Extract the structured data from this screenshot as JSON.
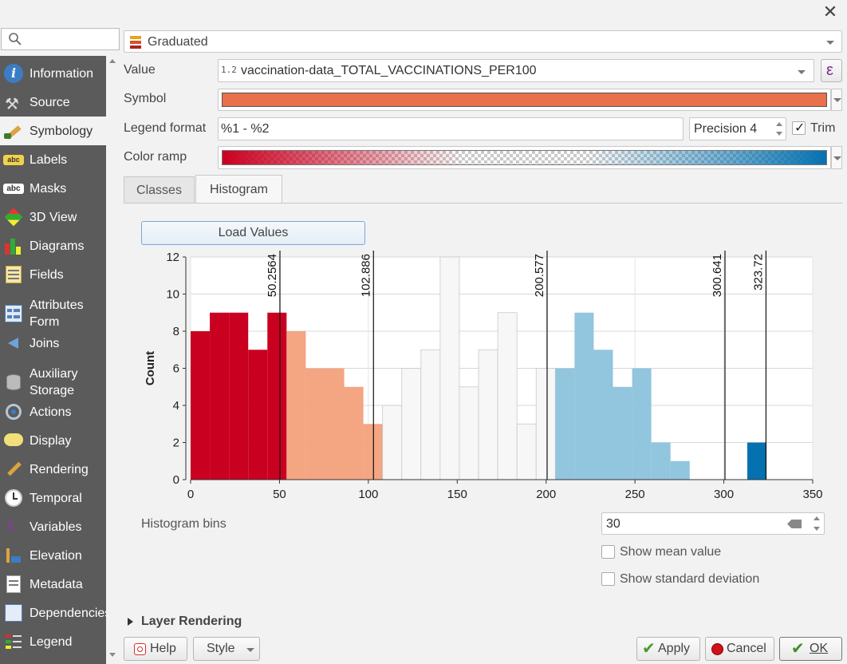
{
  "sidebar": {
    "search_placeholder": "",
    "items": [
      {
        "label": "Information",
        "icon": "info-icon",
        "active": false
      },
      {
        "label": "Source",
        "icon": "source-wrench-icon",
        "active": false
      },
      {
        "label": "Symbology",
        "icon": "paintbrush-icon",
        "active": true
      },
      {
        "label": "Labels",
        "icon": "labels-abc-icon",
        "active": false
      },
      {
        "label": "Masks",
        "icon": "masks-abc-icon",
        "active": false
      },
      {
        "label": "3D View",
        "icon": "cube-3d-icon",
        "active": false
      },
      {
        "label": "Diagrams",
        "icon": "diagrams-icon",
        "active": false
      },
      {
        "label": "Fields",
        "icon": "fields-icon",
        "active": false
      },
      {
        "label": "Attributes\nForm",
        "icon": "attributes-form-icon",
        "active": false
      },
      {
        "label": "Joins",
        "icon": "joins-icon",
        "active": false
      },
      {
        "label": "Auxiliary\nStorage",
        "icon": "auxiliary-storage-icon",
        "active": false
      },
      {
        "label": "Actions",
        "icon": "actions-icon",
        "active": false
      },
      {
        "label": "Display",
        "icon": "display-speech-icon",
        "active": false
      },
      {
        "label": "Rendering",
        "icon": "rendering-brush-icon",
        "active": false
      },
      {
        "label": "Temporal",
        "icon": "clock-icon",
        "active": false
      },
      {
        "label": "Variables",
        "icon": "epsilon-icon",
        "active": false
      },
      {
        "label": "Elevation",
        "icon": "elevation-icon",
        "active": false
      },
      {
        "label": "Metadata",
        "icon": "metadata-icon",
        "active": false
      },
      {
        "label": "Dependencies",
        "icon": "dependencies-icon",
        "active": false
      },
      {
        "label": "Legend",
        "icon": "legend-icon",
        "active": false
      }
    ]
  },
  "renderer": {
    "type_label": "Graduated"
  },
  "form": {
    "value_label": "Value",
    "value_type_badge": "1.2",
    "value_field": "vaccination-data_TOTAL_VACCINATIONS_PER100",
    "symbol_label": "Symbol",
    "symbol_color": "#e8704a",
    "legend_format_label": "Legend format",
    "legend_format_value": "%1 - %2",
    "precision_value": "Precision 4",
    "trim_label": "Trim",
    "trim_checked": true,
    "color_ramp_label": "Color ramp"
  },
  "tabs": [
    {
      "label": "Classes",
      "active": false
    },
    {
      "label": "Histogram",
      "active": true
    }
  ],
  "histogram": {
    "load_values_label": "Load Values",
    "bins_label": "Histogram bins",
    "bins_value": "30",
    "show_mean_label": "Show mean value",
    "show_mean_checked": false,
    "show_std_label": "Show standard deviation",
    "show_std_checked": false
  },
  "chart_data": {
    "type": "bar",
    "title": "",
    "xlabel": "",
    "ylabel": "Count",
    "xlim": [
      0,
      350
    ],
    "ylim": [
      0,
      12
    ],
    "x_ticks": [
      0,
      50,
      100,
      150,
      200,
      250,
      300,
      350
    ],
    "y_ticks": [
      0,
      2,
      4,
      6,
      8,
      10,
      12
    ],
    "grid": true,
    "bins": [
      {
        "x0": 0,
        "x1": 10.8,
        "count": 8,
        "color": "#ca0020"
      },
      {
        "x0": 10.8,
        "x1": 21.6,
        "count": 9,
        "color": "#ca0020"
      },
      {
        "x0": 21.6,
        "x1": 32.4,
        "count": 9,
        "color": "#ca0020"
      },
      {
        "x0": 32.4,
        "x1": 43.2,
        "count": 7,
        "color": "#ca0020"
      },
      {
        "x0": 43.2,
        "x1": 54.0,
        "count": 9,
        "color": "#ca0020"
      },
      {
        "x0": 54.0,
        "x1": 64.8,
        "count": 8,
        "color": "#f4a582"
      },
      {
        "x0": 64.8,
        "x1": 75.6,
        "count": 6,
        "color": "#f4a582"
      },
      {
        "x0": 75.6,
        "x1": 86.4,
        "count": 6,
        "color": "#f4a582"
      },
      {
        "x0": 86.4,
        "x1": 97.2,
        "count": 5,
        "color": "#f4a582"
      },
      {
        "x0": 97.2,
        "x1": 108.0,
        "count": 3,
        "color": "#f4a582"
      },
      {
        "x0": 108.0,
        "x1": 118.8,
        "count": 4,
        "color": "#f7f7f7"
      },
      {
        "x0": 118.8,
        "x1": 129.6,
        "count": 6,
        "color": "#f7f7f7"
      },
      {
        "x0": 129.6,
        "x1": 140.4,
        "count": 7,
        "color": "#f7f7f7"
      },
      {
        "x0": 140.4,
        "x1": 151.2,
        "count": 12,
        "color": "#f7f7f7"
      },
      {
        "x0": 151.2,
        "x1": 162.0,
        "count": 5,
        "color": "#f7f7f7"
      },
      {
        "x0": 162.0,
        "x1": 172.8,
        "count": 7,
        "color": "#f7f7f7"
      },
      {
        "x0": 172.8,
        "x1": 183.6,
        "count": 9,
        "color": "#f7f7f7"
      },
      {
        "x0": 183.6,
        "x1": 194.4,
        "count": 3,
        "color": "#f7f7f7"
      },
      {
        "x0": 194.4,
        "x1": 205.2,
        "count": 6,
        "color": "#f7f7f7"
      },
      {
        "x0": 205.2,
        "x1": 216.0,
        "count": 6,
        "color": "#92c5de"
      },
      {
        "x0": 216.0,
        "x1": 226.8,
        "count": 9,
        "color": "#92c5de"
      },
      {
        "x0": 226.8,
        "x1": 237.6,
        "count": 7,
        "color": "#92c5de"
      },
      {
        "x0": 237.6,
        "x1": 248.4,
        "count": 5,
        "color": "#92c5de"
      },
      {
        "x0": 248.4,
        "x1": 259.2,
        "count": 6,
        "color": "#92c5de"
      },
      {
        "x0": 259.2,
        "x1": 270.0,
        "count": 2,
        "color": "#92c5de"
      },
      {
        "x0": 270.0,
        "x1": 280.8,
        "count": 1,
        "color": "#92c5de"
      },
      {
        "x0": 280.8,
        "x1": 291.6,
        "count": 0,
        "color": "#92c5de"
      },
      {
        "x0": 291.6,
        "x1": 302.4,
        "count": 0,
        "color": "#92c5de"
      },
      {
        "x0": 302.4,
        "x1": 313.2,
        "count": 0,
        "color": "#0571b0"
      },
      {
        "x0": 313.2,
        "x1": 324.0,
        "count": 2,
        "color": "#0571b0"
      }
    ],
    "class_breaks": [
      {
        "value": 50.2564,
        "label": "50.2564"
      },
      {
        "value": 102.886,
        "label": "102.886"
      },
      {
        "value": 200.577,
        "label": "200.577"
      },
      {
        "value": 300.641,
        "label": "300.641"
      },
      {
        "value": 323.72,
        "label": "323.72"
      }
    ]
  },
  "footer": {
    "layer_rendering_label": "Layer Rendering",
    "help_label": "Help",
    "style_label": "Style",
    "apply_label": "Apply",
    "cancel_label": "Cancel",
    "ok_label": "OK"
  }
}
